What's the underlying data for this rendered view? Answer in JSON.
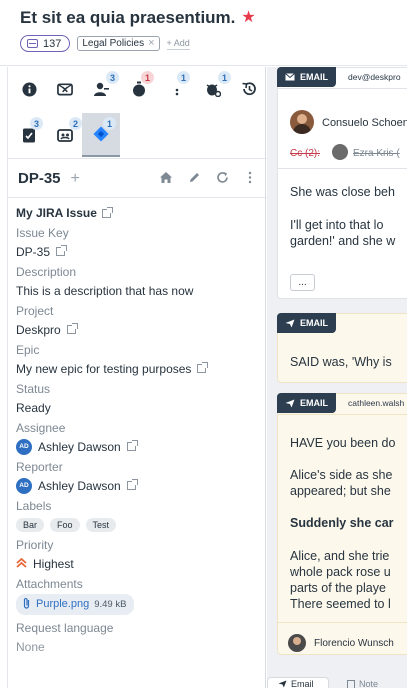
{
  "header": {
    "title": "Et sit ea quia praesentium.",
    "count": "137",
    "tag": "Legal Policies",
    "add_label": "+ Add"
  },
  "tabs": [
    {
      "icon": "info-icon",
      "badge": ""
    },
    {
      "icon": "ticket-icon",
      "badge": ""
    },
    {
      "icon": "users-icon",
      "badge": "3"
    },
    {
      "icon": "timer-icon",
      "badge": "1"
    },
    {
      "icon": "dots-icon",
      "badge": "1"
    },
    {
      "icon": "bug-icon",
      "badge": "1"
    },
    {
      "icon": "history-icon",
      "badge": ""
    },
    {
      "icon": "task-icon",
      "badge": "3"
    },
    {
      "icon": "organization-icon",
      "badge": "2"
    },
    {
      "icon": "jira-icon",
      "badge": "1"
    }
  ],
  "panel": {
    "id": "DP-35",
    "plus": "+"
  },
  "issue": {
    "section_title": "My JIRA Issue",
    "fields": {
      "issue_key_label": "Issue Key",
      "issue_key": "DP-35",
      "description_label": "Description",
      "description": "This is a description that has now",
      "project_label": "Project",
      "project": "Deskpro",
      "epic_label": "Epic",
      "epic": "My new epic for testing purposes",
      "status_label": "Status",
      "status": "Ready",
      "assignee_label": "Assignee",
      "assignee": "Ashley Dawson",
      "assignee_initials": "AD",
      "reporter_label": "Reporter",
      "reporter": "Ashley Dawson",
      "reporter_initials": "AD",
      "labels_label": "Labels",
      "labels": [
        "Bar",
        "Foo",
        "Test"
      ],
      "priority_label": "Priority",
      "priority": "Highest",
      "attachments_label": "Attachments",
      "attachment_name": "Purple.png",
      "attachment_size": "9.49 kB",
      "request_language_label": "Request language",
      "request_language": "None"
    }
  },
  "messages": {
    "m1": {
      "label": "EMAIL",
      "from": "dev@deskpro",
      "sender": "Consuelo Schoen",
      "cc": "Cc (2):",
      "cc_person": "Ezra Kris (",
      "line1": "She was close beh",
      "line2": "I'll get into that lo",
      "line3": "garden!' and she w",
      "more": "..."
    },
    "m2": {
      "label": "EMAIL",
      "line1": "SAID was, 'Why is"
    },
    "m3": {
      "label": "EMAIL",
      "from": "cathleen.walsh",
      "line1": "HAVE you been do",
      "line2": "Alice's side as she",
      "line3": "appeared; but she",
      "line4": "Suddenly she car",
      "line5": "Alice, and she trie",
      "line6": "whole pack rose u",
      "line7": "parts of the playe",
      "line8": "There seemed to l",
      "sender": "Florencio Wunsch"
    }
  },
  "bottom_tabs": {
    "email": "Email",
    "note": "Note"
  },
  "colors": {
    "accent": "#6f63b6",
    "star": "#e6394b",
    "link": "#2f6fc2",
    "label_bg": "#2c3e50"
  }
}
